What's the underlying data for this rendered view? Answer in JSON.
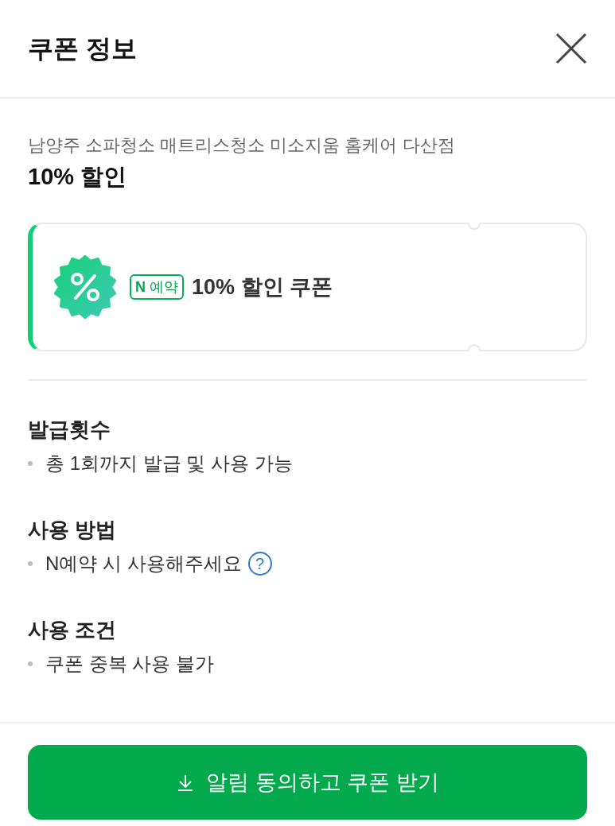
{
  "header": {
    "title": "쿠폰 정보"
  },
  "store": {
    "name": "남양주 소파청소 매트리스청소 미소지움 홈케어 다산점",
    "discount": "10% 할인"
  },
  "coupon": {
    "badge": "**N** 예약",
    "title": "10% 할인 쿠폰"
  },
  "sections": [
    {
      "title": "발급횟수",
      "items": [
        {
          "text": "총 1회까지 발급 및 사용 가능"
        }
      ]
    },
    {
      "title": "사용 방법",
      "items": [
        {
          "text": "N예약 시 사용해주세요",
          "help": "?"
        }
      ]
    },
    {
      "title": "사용 조건",
      "items": [
        {
          "text": "쿠폰 중복 사용 불가"
        }
      ]
    }
  ],
  "button": {
    "label": "알림 동의하고 쿠폰 받기"
  }
}
